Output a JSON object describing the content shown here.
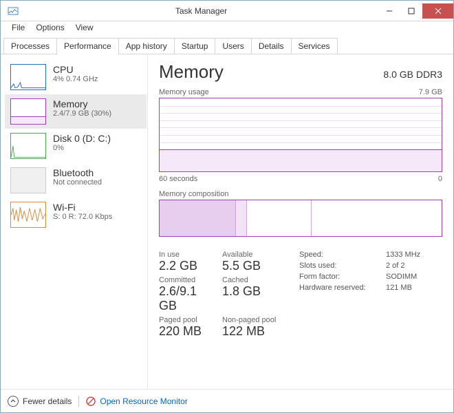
{
  "window": {
    "title": "Task Manager"
  },
  "menu": {
    "file": "File",
    "options": "Options",
    "view": "View"
  },
  "tabs": [
    "Processes",
    "Performance",
    "App history",
    "Startup",
    "Users",
    "Details",
    "Services"
  ],
  "tabs_active_index": 1,
  "sidebar": {
    "cpu": {
      "title": "CPU",
      "sub": "4% 0.74 GHz"
    },
    "mem": {
      "title": "Memory",
      "sub": "2.4/7.9 GB (30%)"
    },
    "disk": {
      "title": "Disk 0 (D: C:)",
      "sub": "0%"
    },
    "bt": {
      "title": "Bluetooth",
      "sub": "Not connected"
    },
    "wifi": {
      "title": "Wi-Fi",
      "sub": "S: 0 R: 72.0 Kbps"
    }
  },
  "main": {
    "heading": "Memory",
    "spec": "8.0 GB DDR3",
    "usage_label": "Memory usage",
    "usage_max": "7.9 GB",
    "axis_left": "60 seconds",
    "axis_right": "0",
    "comp_label": "Memory composition",
    "stats": {
      "inuse_lbl": "In use",
      "inuse": "2.2 GB",
      "avail_lbl": "Available",
      "avail": "5.5 GB",
      "commit_lbl": "Committed",
      "commit": "2.6/9.1 GB",
      "cached_lbl": "Cached",
      "cached": "1.8 GB",
      "paged_lbl": "Paged pool",
      "paged": "220 MB",
      "npaged_lbl": "Non-paged pool",
      "npaged": "122 MB",
      "speed_lbl": "Speed:",
      "speed": "1333 MHz",
      "slots_lbl": "Slots used:",
      "slots": "2 of 2",
      "form_lbl": "Form factor:",
      "form": "SODIMM",
      "hw_lbl": "Hardware reserved:",
      "hw": "121 MB"
    }
  },
  "footer": {
    "fewer": "Fewer details",
    "rm": "Open Resource Monitor"
  },
  "chart_data": {
    "type": "area",
    "title": "Memory usage",
    "ylim": [
      0,
      7.9
    ],
    "ylabel": "GB",
    "xlabel": "seconds",
    "xlim": [
      60,
      0
    ],
    "series": [
      {
        "name": "Memory",
        "values_approx_flat": 2.4
      }
    ],
    "composition": {
      "in_use_gb": 2.2,
      "modified_gb": 0.3,
      "standby_gb": 1.8,
      "free_gb": 3.6,
      "total_gb": 7.9
    }
  }
}
